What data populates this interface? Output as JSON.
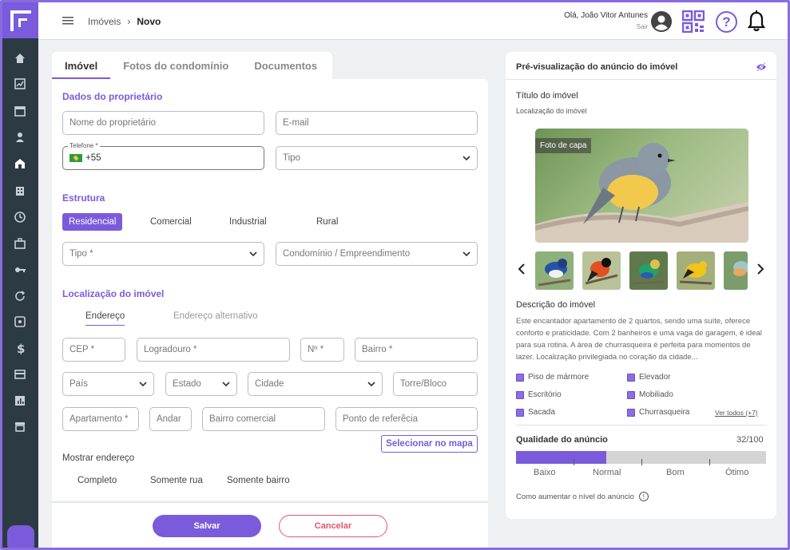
{
  "header": {
    "breadcrumb": [
      "Imóveis",
      "Novo"
    ],
    "greeting": "Olá, João Vitor Antunes",
    "logout": "Sair",
    "help": "?"
  },
  "tabs": [
    "Imóvel",
    "Fotos do condomínio",
    "Documentos"
  ],
  "owner": {
    "title": "Dados do proprietário",
    "name_placeholder": "Nome do proprietário",
    "email_placeholder": "E-mail",
    "phone_label": "Telefone *",
    "phone_value": "+55",
    "type_placeholder": "Tipo"
  },
  "structure": {
    "title": "Estrutura",
    "options": [
      "Residencial",
      "Comercial",
      "Industrial",
      "Rural"
    ],
    "type_placeholder": "Tipo *",
    "condo_placeholder": "Condomínio / Empreendimento"
  },
  "location": {
    "title": "Localização do imóvel",
    "subtabs": [
      "Endereço",
      "Endereço alternativo"
    ],
    "cep": "CEP *",
    "street": "Logradouro *",
    "number": "Nº *",
    "district": "Bairro *",
    "country": "País",
    "state": "Estado",
    "city": "Cidade",
    "tower": "Torre/Bloco",
    "apartment": "Apartamento *",
    "floor": "Andar",
    "commercial_district": "Bairro comercial",
    "reference": "Ponto de referêcia",
    "map_button": "Selecionar no mapa",
    "show_address": "Mostrar endereço",
    "show_options": [
      "Completo",
      "Somente rua",
      "Somente bairro"
    ]
  },
  "footer": {
    "save": "Salvar",
    "cancel": "Cancelar"
  },
  "preview": {
    "title": "Pré-visualização do anúncio do imóvel",
    "listing_title": "Título do imóvel",
    "listing_location": "Localização do imóvel",
    "cover_tag": "Foto de capa",
    "description_title": "Descrição do imóvel",
    "description": "Este encantador apartamento de 2 quartos, sendo uma suíte, oferece conforto e praticidade. Com 2 banheiros e uma vaga de garagem, é ideal para sua rotina. A área de churrasqueira é perfeita para momentos de lazer. Localização privilegiada no coração da cidade...",
    "features": [
      "Piso de mármore",
      "Elevador",
      "Escritório",
      "Mobiliado",
      "Sacada",
      "Churrasqueira"
    ],
    "see_all": "Ver todos (+7)",
    "quality_title": "Qualidade do anúncio",
    "quality_score": "32/100",
    "quality_fraction": 0.36,
    "quality_levels": [
      "Baixo",
      "Normal",
      "Bom",
      "Ótimo"
    ],
    "improve": "Como aumentar o nível do anúncio",
    "info_glyph": "!"
  },
  "colors": {
    "accent": "#7a5bdc",
    "sidebar": "#2c3a43",
    "danger": "#e3586a"
  }
}
